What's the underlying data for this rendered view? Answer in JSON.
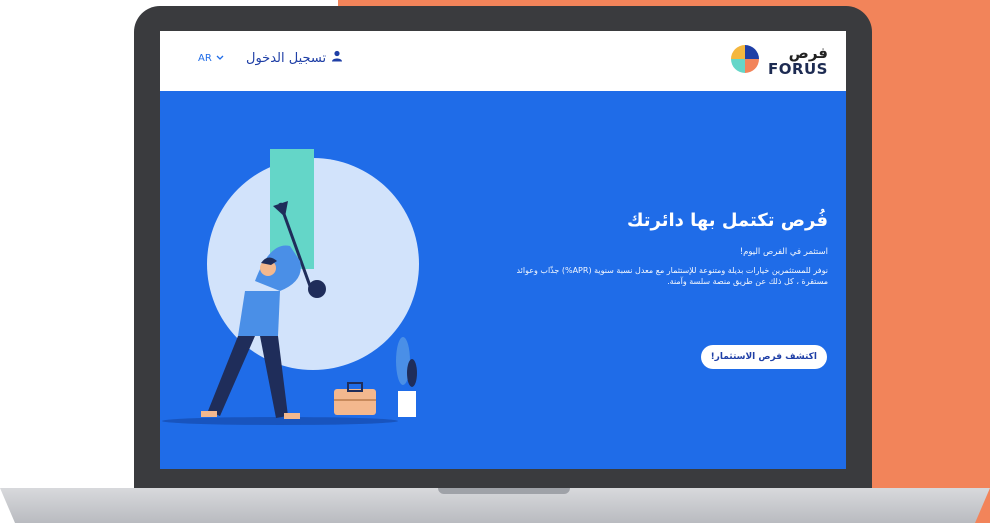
{
  "header": {
    "logo": {
      "arabic": "فرص",
      "english": "FORUS"
    },
    "login_label": "تسجيل الدخول",
    "language_label": "AR"
  },
  "hero": {
    "title": "فُرص تكتمل بها دائرتك",
    "subtitle": "استثمر في الفرص اليوم!",
    "description": "نوفر للمستثمرين خيارات بديلة ومتنوعة للإستثمار مع معدل نسبة سنوية (APR%) جذّاب وعوائد مستقرة ، كل ذلك عن طريق منصة سلسة وآمنة.",
    "cta_label": "اكتشف فرص الاستثمار!"
  },
  "colors": {
    "accent": "#1f6ce8",
    "orange": "#f2845a",
    "teal": "#64d6c8"
  },
  "icons": [
    "user-icon",
    "chevron-down-icon",
    "forus-logo-icon"
  ]
}
